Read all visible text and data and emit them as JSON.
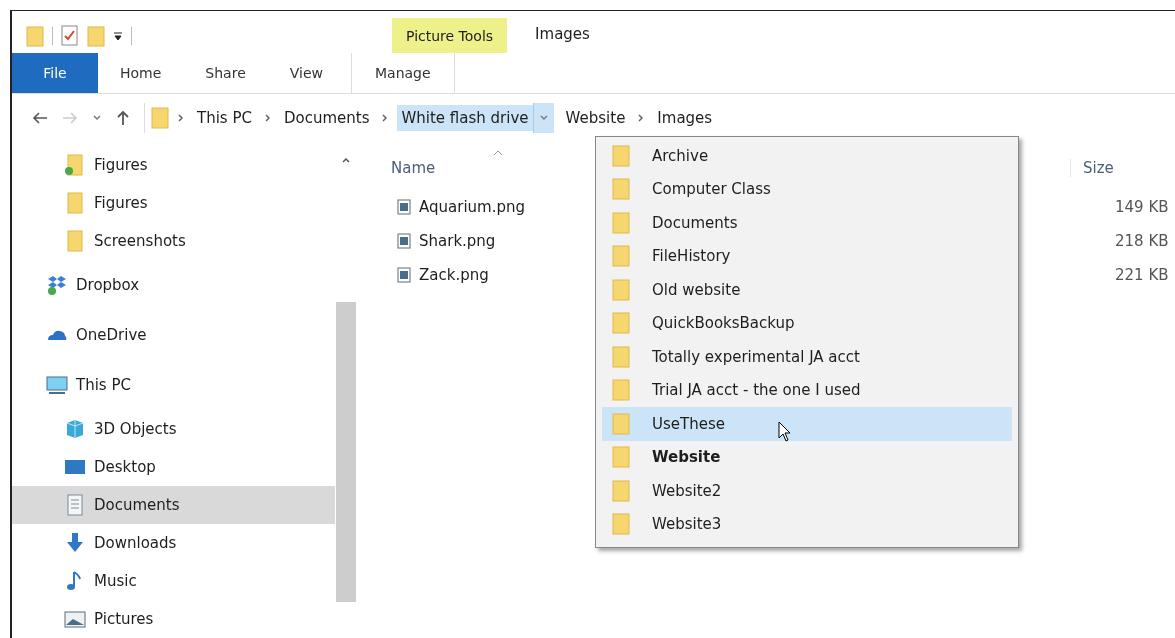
{
  "window": {
    "title": "Images",
    "context_tab_group": "Picture Tools"
  },
  "ribbon_tabs": [
    {
      "label": "File",
      "kind": "file",
      "selected": false
    },
    {
      "label": "Home",
      "kind": "tab",
      "selected": false
    },
    {
      "label": "Share",
      "kind": "tab",
      "selected": false
    },
    {
      "label": "View",
      "kind": "tab",
      "selected": false
    },
    {
      "label": "Manage",
      "kind": "context",
      "selected": false
    }
  ],
  "address_bar": {
    "crumbs": [
      {
        "label": "This PC",
        "selected": false,
        "expanded": false
      },
      {
        "label": "Documents",
        "selected": false,
        "expanded": false
      },
      {
        "label": "White flash drive",
        "selected": true,
        "expanded": true
      },
      {
        "label": "Website",
        "selected": false,
        "expanded": false
      },
      {
        "label": "Images",
        "selected": false,
        "expanded": false
      }
    ]
  },
  "sidebar": {
    "items": [
      {
        "label": "Figures",
        "kind": "folder-synced",
        "selected": false,
        "indented": true
      },
      {
        "label": "Figures",
        "kind": "folder",
        "selected": false,
        "indented": true
      },
      {
        "label": "Screenshots",
        "kind": "folder",
        "selected": false,
        "indented": true
      },
      {
        "label": "Dropbox",
        "kind": "dropbox",
        "selected": false,
        "indented": false
      },
      {
        "label": "OneDrive",
        "kind": "onedrive",
        "selected": false,
        "indented": false
      },
      {
        "label": "This PC",
        "kind": "pc",
        "selected": false,
        "indented": false,
        "children": [
          {
            "label": "3D Objects",
            "kind": "objects3d",
            "selected": false
          },
          {
            "label": "Desktop",
            "kind": "desktop",
            "selected": false
          },
          {
            "label": "Documents",
            "kind": "documents",
            "selected": true
          },
          {
            "label": "Downloads",
            "kind": "downloads",
            "selected": false
          },
          {
            "label": "Music",
            "kind": "music",
            "selected": false
          },
          {
            "label": "Pictures",
            "kind": "pictures",
            "selected": false
          }
        ]
      }
    ]
  },
  "file_list": {
    "columns": [
      "Name",
      "Size"
    ],
    "rows": [
      {
        "name": "Aquarium.png",
        "size": "149 KB"
      },
      {
        "name": "Shark.png",
        "size": "218 KB"
      },
      {
        "name": "Zack.png",
        "size": "221 KB"
      }
    ]
  },
  "dropdown": {
    "items": [
      {
        "label": "Archive",
        "selected": false,
        "current": false
      },
      {
        "label": "Computer Class",
        "selected": false,
        "current": false
      },
      {
        "label": "Documents",
        "selected": false,
        "current": false
      },
      {
        "label": "FileHistory",
        "selected": false,
        "current": false
      },
      {
        "label": "Old website",
        "selected": false,
        "current": false
      },
      {
        "label": "QuickBooksBackup",
        "selected": false,
        "current": false
      },
      {
        "label": "Totally experimental JA acct",
        "selected": false,
        "current": false
      },
      {
        "label": "Trial JA acct - the one I used",
        "selected": false,
        "current": false
      },
      {
        "label": "UseThese",
        "selected": true,
        "current": false
      },
      {
        "label": "Website",
        "selected": false,
        "current": true
      },
      {
        "label": "Website2",
        "selected": false,
        "current": false
      },
      {
        "label": "Website3",
        "selected": false,
        "current": false
      }
    ]
  }
}
